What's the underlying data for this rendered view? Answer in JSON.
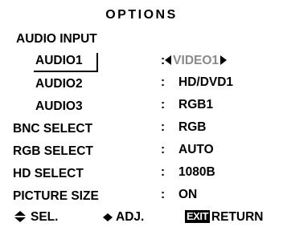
{
  "title": "OPTIONS",
  "rows": [
    {
      "label": "AUDIO INPUT",
      "separator": "",
      "value": ""
    },
    {
      "label": "AUDIO1",
      "separator": ":",
      "value": "VIDEO1"
    },
    {
      "label": "AUDIO2",
      "separator": ":",
      "value": "HD/DVD1"
    },
    {
      "label": "AUDIO3",
      "separator": ":",
      "value": "RGB1"
    },
    {
      "label": "BNC SELECT",
      "separator": ":",
      "value": "RGB"
    },
    {
      "label": "RGB SELECT",
      "separator": ":",
      "value": "AUTO"
    },
    {
      "label": "HD SELECT",
      "separator": ":",
      "value": "1080B"
    },
    {
      "label": "PICTURE SIZE",
      "separator": ":",
      "value": "ON"
    }
  ],
  "footer": {
    "sel_label": "SEL.",
    "adj_label": "ADJ.",
    "exit_badge": "EXIT",
    "return_label": "RETURN"
  },
  "icons": {
    "sel": "up-down-arrows-icon",
    "adj": "left-right-arrows-icon"
  },
  "colors": {
    "background": "#ffffff",
    "text": "#000000",
    "selected_value": "#8a8a8a"
  }
}
